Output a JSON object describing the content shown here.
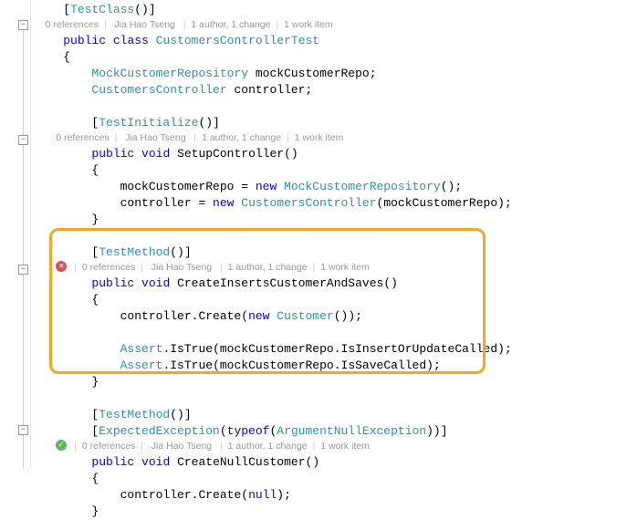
{
  "attributes": {
    "testClass": "TestClass",
    "testInitialize": "TestInitialize",
    "testMethod": "TestMethod",
    "expectedException": "ExpectedException",
    "argumentNullException": "ArgumentNullException",
    "typeof": "typeof"
  },
  "keywords": {
    "public": "public",
    "class": "class",
    "void": "void",
    "new": "new",
    "null": "null"
  },
  "types": {
    "mockCustomerRepository": "MockCustomerRepository",
    "customersController": "CustomersController",
    "customer": "Customer",
    "assert": "Assert"
  },
  "classDecl": {
    "name": "CustomersControllerTest"
  },
  "fields": {
    "repoVar": "mockCustomerRepo",
    "controllerVar": "controller"
  },
  "methods": {
    "setup": "SetupController",
    "createInserts": "CreateInsertsCustomerAndSaves",
    "createNull": "CreateNullCustomer"
  },
  "calls": {
    "create": "Create",
    "isTrue": "IsTrue",
    "isInsertOrUpdate": "IsInsertOrUpdateCalled",
    "isSave": "IsSaveCalled"
  },
  "codelens": {
    "references": "0 references",
    "author": "Jia Hao Tseng",
    "changes": "1 author, 1 change",
    "workitem": "1 work item"
  }
}
